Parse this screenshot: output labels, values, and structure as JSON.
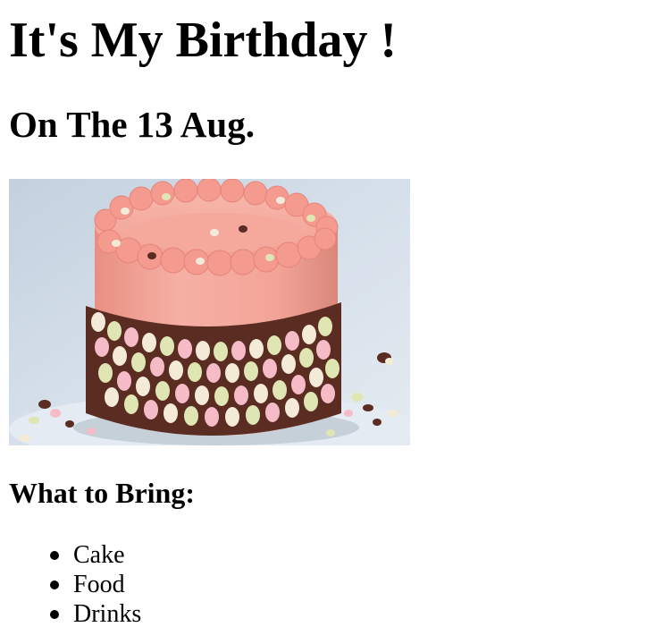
{
  "page": {
    "title": "It's My Birthday !",
    "date_heading": "On The 13 Aug.",
    "image": {
      "subject": "pink-frosted-birthday-cake",
      "colors": {
        "background": "#c9d6e3",
        "frosting": "#f3a59a",
        "cake_side": "#f0a294",
        "chocolate": "#5a2c22",
        "candy_pink": "#f5bcc8",
        "candy_green": "#dfe6b4",
        "candy_white": "#f3ead8",
        "plate": "#dfe6ee"
      }
    },
    "bring_heading": "What to Bring:",
    "bring_items": [
      "Cake",
      "Food",
      "Drinks"
    ]
  }
}
